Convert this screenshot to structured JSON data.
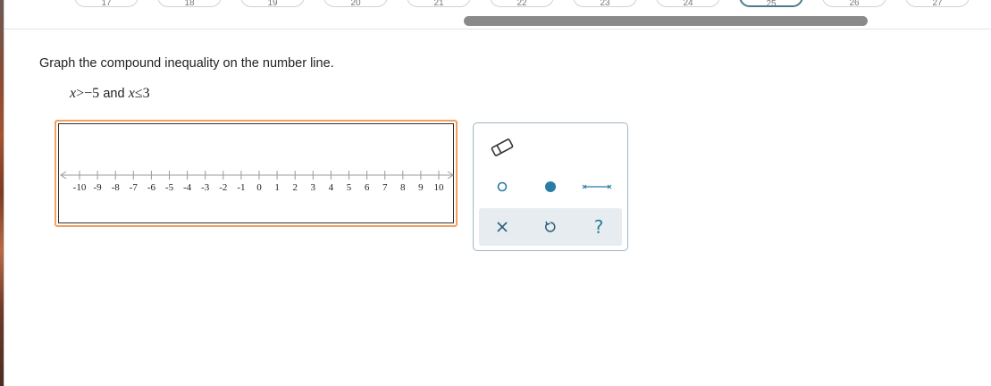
{
  "nav": {
    "pills": [
      {
        "label": "17"
      },
      {
        "label": "18"
      },
      {
        "label": "19"
      },
      {
        "label": "20"
      },
      {
        "label": "21"
      },
      {
        "label": "22"
      },
      {
        "label": "23"
      },
      {
        "label": "24"
      },
      {
        "label": "25",
        "active": true
      },
      {
        "label": "26"
      },
      {
        "label": "27"
      }
    ]
  },
  "question": {
    "prompt": "Graph the compound inequality on the number line.",
    "inequality": {
      "var1": "x",
      "op1": ">",
      "val1": "−5",
      "conj": "and",
      "var2": "x",
      "op2": "≤",
      "val2": "3"
    }
  },
  "number_line": {
    "min": -10,
    "max": 10,
    "tick_labels": [
      "-10",
      "-9",
      "-8",
      "-7",
      "-6",
      "-5",
      "-4",
      "-3",
      "-2",
      "-1",
      "0",
      "1",
      "2",
      "3",
      "4",
      "5",
      "6",
      "7",
      "8",
      "9",
      "10"
    ]
  },
  "palette": {
    "tools": [
      "eraser-icon",
      "open-point-icon",
      "closed-point-icon",
      "segment-icon"
    ],
    "footer": {
      "clear_icon": "x-icon",
      "undo_icon": "undo-icon",
      "help_label": "?"
    }
  },
  "colors": {
    "accent": "#2a7ba5",
    "active_border": "#f5a05c",
    "palette_border": "#9fb6c4"
  }
}
